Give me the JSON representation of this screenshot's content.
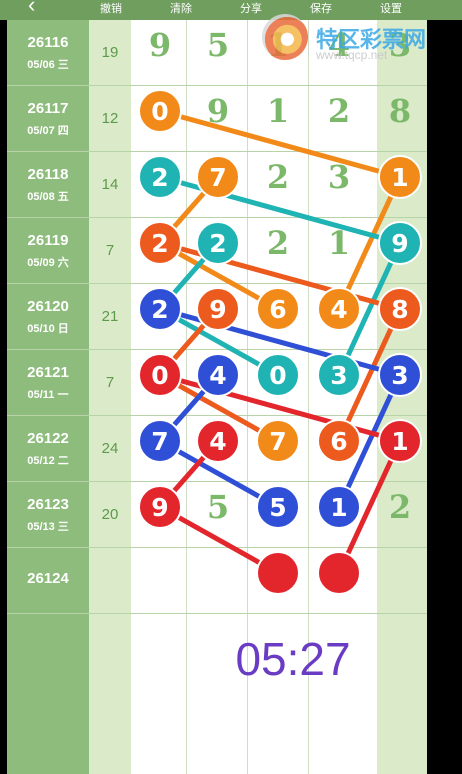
{
  "toolbar": {
    "back_icon": "chevron-left-icon",
    "undo_label": "撤销",
    "clear_label": "清除",
    "share_label": "分享",
    "save_label": "保存",
    "settings_label": "设置"
  },
  "watermark": {
    "brand": "特区彩票网",
    "url": "www.tqcp.net"
  },
  "rows": [
    {
      "issue": "26116",
      "date": "05/06 三",
      "sum": "19"
    },
    {
      "issue": "26117",
      "date": "05/07 四",
      "sum": "12"
    },
    {
      "issue": "26118",
      "date": "05/08 五",
      "sum": "14"
    },
    {
      "issue": "26119",
      "date": "05/09 六",
      "sum": "7"
    },
    {
      "issue": "26120",
      "date": "05/10 日",
      "sum": "21"
    },
    {
      "issue": "26121",
      "date": "05/11 一",
      "sum": "7"
    },
    {
      "issue": "26122",
      "date": "05/12 二",
      "sum": "24"
    },
    {
      "issue": "26123",
      "date": "05/13 三",
      "sum": "20"
    },
    {
      "issue": "26124",
      "date": "",
      "sum": ""
    }
  ],
  "timer": "05:27",
  "colors": {
    "orange": "#f28a1a",
    "cyan": "#1fb3b3",
    "red_orange": "#ec5a1e",
    "blue": "#2f4fd6",
    "red": "#e3262c",
    "green_digit": "#7cb86a",
    "left_column": "#8ebc7c"
  },
  "grid_digits": [
    {
      "row": 0,
      "col": 0,
      "v": "9"
    },
    {
      "row": 0,
      "col": 1,
      "v": "5"
    },
    {
      "row": 0,
      "col": 2,
      "v": "1"
    },
    {
      "row": 0,
      "col": 3,
      "v": "4"
    },
    {
      "row": 0,
      "col": 4,
      "v": "3"
    },
    {
      "row": 1,
      "col": 1,
      "v": "9"
    },
    {
      "row": 1,
      "col": 2,
      "v": "1"
    },
    {
      "row": 1,
      "col": 3,
      "v": "2"
    },
    {
      "row": 1,
      "col": 4,
      "v": "8"
    },
    {
      "row": 2,
      "col": 2,
      "v": "2"
    },
    {
      "row": 2,
      "col": 3,
      "v": "3"
    },
    {
      "row": 3,
      "col": 2,
      "v": "2"
    },
    {
      "row": 3,
      "col": 3,
      "v": "1"
    },
    {
      "row": 7,
      "col": 1,
      "v": "5"
    },
    {
      "row": 7,
      "col": 4,
      "v": "2"
    }
  ],
  "balls": [
    {
      "row": 1,
      "col": 0,
      "v": "0",
      "color": "#f28a1a"
    },
    {
      "row": 2,
      "col": 0,
      "v": "2",
      "color": "#1fb3b3"
    },
    {
      "row": 2,
      "col": 1,
      "v": "7",
      "color": "#f28a1a"
    },
    {
      "row": 2,
      "col": 4,
      "v": "1",
      "color": "#f28a1a"
    },
    {
      "row": 3,
      "col": 0,
      "v": "2",
      "color": "#ec5a1e"
    },
    {
      "row": 3,
      "col": 1,
      "v": "2",
      "color": "#1fb3b3"
    },
    {
      "row": 3,
      "col": 4,
      "v": "9",
      "color": "#1fb3b3"
    },
    {
      "row": 4,
      "col": 0,
      "v": "2",
      "color": "#2f4fd6"
    },
    {
      "row": 4,
      "col": 1,
      "v": "9",
      "color": "#ec5a1e"
    },
    {
      "row": 4,
      "col": 2,
      "v": "6",
      "color": "#f28a1a"
    },
    {
      "row": 4,
      "col": 3,
      "v": "4",
      "color": "#f28a1a"
    },
    {
      "row": 4,
      "col": 4,
      "v": "8",
      "color": "#ec5a1e"
    },
    {
      "row": 5,
      "col": 0,
      "v": "0",
      "color": "#e3262c"
    },
    {
      "row": 5,
      "col": 1,
      "v": "4",
      "color": "#2f4fd6"
    },
    {
      "row": 5,
      "col": 2,
      "v": "0",
      "color": "#1fb3b3"
    },
    {
      "row": 5,
      "col": 3,
      "v": "3",
      "color": "#1fb3b3"
    },
    {
      "row": 5,
      "col": 4,
      "v": "3",
      "color": "#2f4fd6"
    },
    {
      "row": 6,
      "col": 0,
      "v": "7",
      "color": "#2f4fd6"
    },
    {
      "row": 6,
      "col": 1,
      "v": "4",
      "color": "#e3262c"
    },
    {
      "row": 6,
      "col": 2,
      "v": "7",
      "color": "#f28a1a"
    },
    {
      "row": 6,
      "col": 3,
      "v": "6",
      "color": "#ec5a1e"
    },
    {
      "row": 6,
      "col": 4,
      "v": "1",
      "color": "#e3262c"
    },
    {
      "row": 7,
      "col": 0,
      "v": "9",
      "color": "#e3262c"
    },
    {
      "row": 7,
      "col": 2,
      "v": "5",
      "color": "#2f4fd6"
    },
    {
      "row": 7,
      "col": 3,
      "v": "1",
      "color": "#2f4fd6"
    },
    {
      "row": 8,
      "col": 2,
      "v": "",
      "color": "#e3262c"
    },
    {
      "row": 8,
      "col": 3,
      "v": "",
      "color": "#e3262c"
    }
  ],
  "links": [
    {
      "from": [
        1,
        0
      ],
      "to": [
        2,
        4
      ],
      "color": "#f28a1a"
    },
    {
      "from": [
        2,
        4
      ],
      "to": [
        4,
        3
      ],
      "color": "#f28a1a"
    },
    {
      "from": [
        2,
        1
      ],
      "to": [
        3,
        0
      ],
      "color": "#f28a1a"
    },
    {
      "from": [
        3,
        0
      ],
      "to": [
        4,
        2
      ],
      "color": "#f28a1a"
    },
    {
      "from": [
        2,
        0
      ],
      "to": [
        3,
        4
      ],
      "color": "#1fb3b3"
    },
    {
      "from": [
        3,
        4
      ],
      "to": [
        5,
        3
      ],
      "color": "#1fb3b3"
    },
    {
      "from": [
        3,
        1
      ],
      "to": [
        4,
        0
      ],
      "color": "#1fb3b3"
    },
    {
      "from": [
        4,
        0
      ],
      "to": [
        5,
        2
      ],
      "color": "#1fb3b3"
    },
    {
      "from": [
        3,
        0
      ],
      "to": [
        4,
        4
      ],
      "color": "#ec5a1e"
    },
    {
      "from": [
        4,
        4
      ],
      "to": [
        6,
        3
      ],
      "color": "#ec5a1e"
    },
    {
      "from": [
        4,
        1
      ],
      "to": [
        5,
        0
      ],
      "color": "#ec5a1e"
    },
    {
      "from": [
        5,
        0
      ],
      "to": [
        6,
        2
      ],
      "color": "#ec5a1e"
    },
    {
      "from": [
        4,
        0
      ],
      "to": [
        5,
        4
      ],
      "color": "#2f4fd6"
    },
    {
      "from": [
        5,
        4
      ],
      "to": [
        7,
        3
      ],
      "color": "#2f4fd6"
    },
    {
      "from": [
        5,
        1
      ],
      "to": [
        6,
        0
      ],
      "color": "#2f4fd6"
    },
    {
      "from": [
        6,
        0
      ],
      "to": [
        7,
        2
      ],
      "color": "#2f4fd6"
    },
    {
      "from": [
        5,
        0
      ],
      "to": [
        6,
        4
      ],
      "color": "#e3262c"
    },
    {
      "from": [
        6,
        4
      ],
      "to": [
        8,
        3
      ],
      "color": "#e3262c"
    },
    {
      "from": [
        6,
        1
      ],
      "to": [
        7,
        0
      ],
      "color": "#e3262c"
    },
    {
      "from": [
        7,
        0
      ],
      "to": [
        8,
        2
      ],
      "color": "#e3262c"
    }
  ]
}
